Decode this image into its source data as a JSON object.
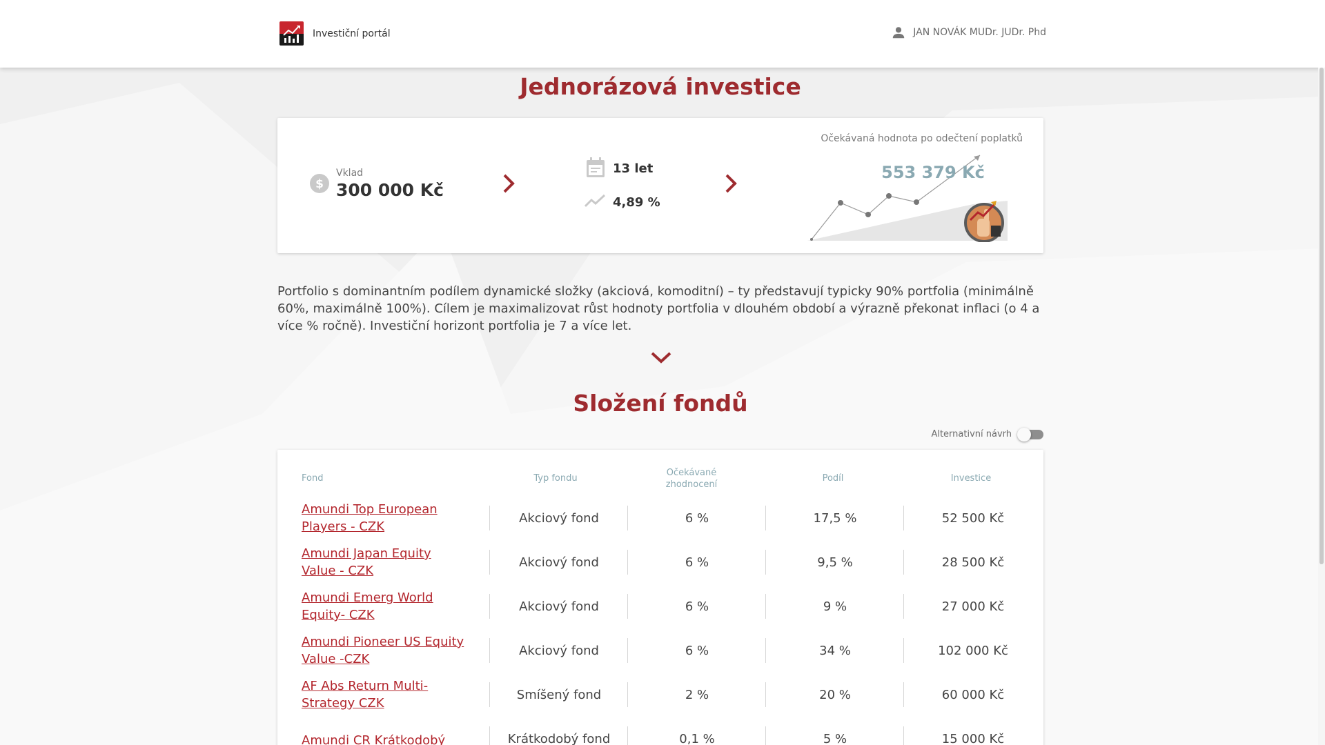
{
  "header": {
    "brand": "Investiční portál",
    "user_name": "JAN NOVÁK MUDr. JUDr. Phd"
  },
  "page_title": "Jednorázová investice",
  "summary": {
    "deposit_label": "Vklad",
    "deposit_value": "300 000 Kč",
    "years": "13 let",
    "rate": "4,89 %",
    "expected_label": "Očekávaná hodnota po odečtení poplatků",
    "expected_value": "553 379 Kč"
  },
  "description": "Portfolio s dominantním podílem dynamické složky (akciová, komoditní) – ty představují typicky 90% portfolia (minimálně 60%, maximálně 100%). Cílem je maximalizovat růst hodnoty portfolia v dlouhém období a výrazně překonat inflaci (o 4 a více % ročně). Investiční horizont portfolia je 7 a více let.",
  "section_title": "Složení fondů",
  "alt_toggle_label": "Alternativní návrh",
  "table": {
    "headers": {
      "fund": "Fond",
      "type": "Typ fondu",
      "expected": "Očekávané zhodnocení",
      "share": "Podíl",
      "investment": "Investice"
    },
    "rows": [
      {
        "fund": "Amundi Top European Players - CZK",
        "type": "Akciový fond",
        "expected": "6 %",
        "share": "17,5 %",
        "investment": "52 500 Kč"
      },
      {
        "fund": "Amundi Japan Equity Value - CZK",
        "type": "Akciový fond",
        "expected": "6 %",
        "share": "9,5 %",
        "investment": "28 500 Kč"
      },
      {
        "fund": "Amundi Emerg World Equity- CZK",
        "type": "Akciový fond",
        "expected": "6 %",
        "share": "9 %",
        "investment": "27 000 Kč"
      },
      {
        "fund": "Amundi Pioneer US Equity Value -CZK",
        "type": "Akciový fond",
        "expected": "6 %",
        "share": "34 %",
        "investment": "102 000 Kč"
      },
      {
        "fund": "AF Abs Return Multi-Strategy CZK",
        "type": "Smíšený fond",
        "expected": "2 %",
        "share": "20 %",
        "investment": "60 000 Kč"
      },
      {
        "fund": "Amundi CR Krátkodobý",
        "type": "Krátkodobý fond",
        "expected": "0,1 %",
        "share": "5 %",
        "investment": "15 000 Kč"
      }
    ]
  },
  "colors": {
    "accent": "#9e2b2f",
    "link": "#b3262d",
    "muted_blue": "#8aa9b2"
  },
  "icons": [
    "logo-icon",
    "user-icon",
    "dollar-icon",
    "chevron-right-icon",
    "calendar-icon",
    "trend-icon",
    "growth-chart-illustration",
    "chevron-down-icon"
  ]
}
